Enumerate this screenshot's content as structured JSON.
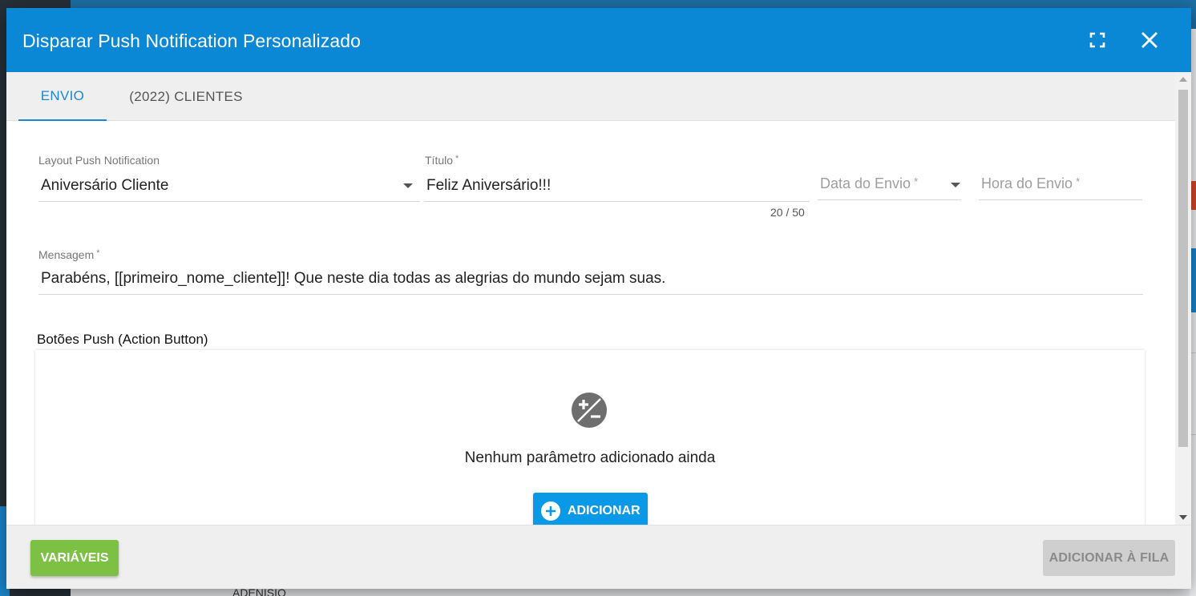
{
  "background": {
    "partial_text": "ADENISIO"
  },
  "dialog": {
    "title": "Disparar Push Notification Personalizado",
    "fullscreen_icon": "fullscreen-icon",
    "close_icon": "close-icon"
  },
  "tabs": [
    {
      "label": "ENVIO",
      "active": true
    },
    {
      "label": "(2022) CLIENTES",
      "active": false
    }
  ],
  "form": {
    "layout": {
      "label": "Layout Push Notification",
      "value": "Aniversário Cliente"
    },
    "titulo": {
      "label": "Título",
      "required_mark": "*",
      "value": "Feliz Aniversário!!!",
      "counter": "20 / 50"
    },
    "data_envio": {
      "placeholder": "Data do Envio",
      "required_mark": "*"
    },
    "hora_envio": {
      "placeholder": "Hora do Envio",
      "required_mark": "*"
    },
    "mensagem": {
      "label": "Mensagem",
      "required_mark": "*",
      "value": "Parabéns, [[primeiro_nome_cliente]]! Que neste dia todas as alegrias do mundo sejam suas."
    }
  },
  "action_buttons": {
    "section_title": "Botões Push (Action Button)",
    "empty_icon": "plus-minus-icon",
    "empty_text": "Nenhum parâmetro adicionado ainda",
    "add_label": "ADICIONAR"
  },
  "footer": {
    "variables_label": "VARIÁVEIS",
    "queue_label": "ADICIONAR À FILA"
  },
  "colors": {
    "header": "#0a88d5",
    "accent": "#1b87cf",
    "add_button": "#0a99e6",
    "variables_button": "#7cc143",
    "queue_button_disabled": "#cfcfcf"
  }
}
